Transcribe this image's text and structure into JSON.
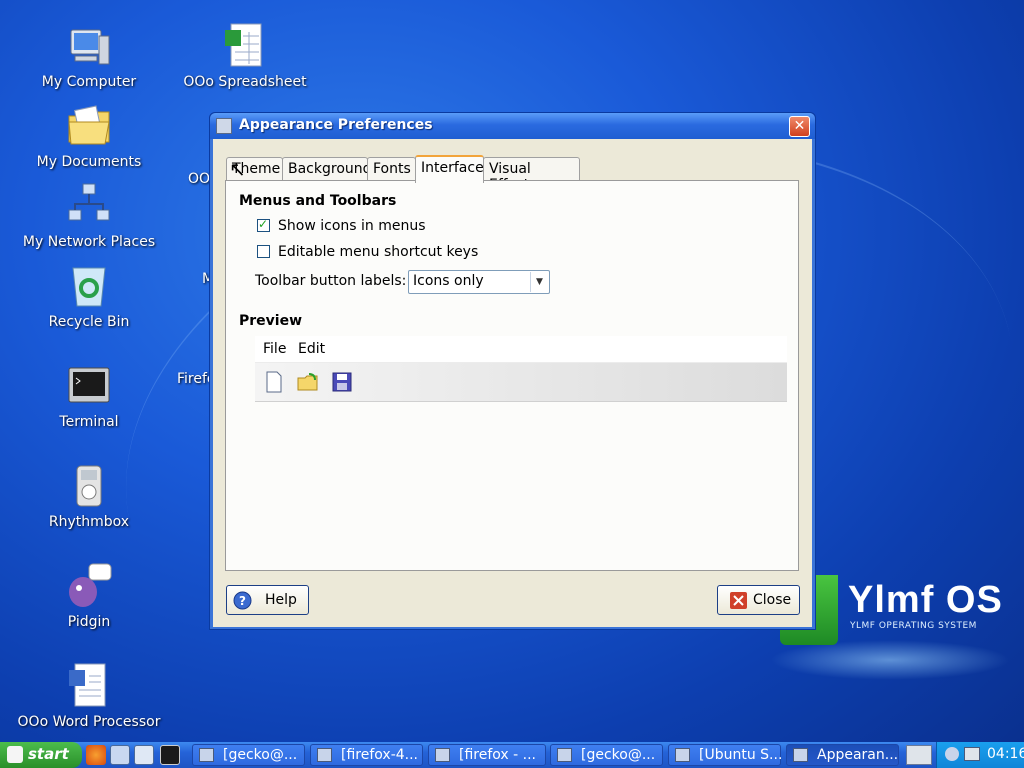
{
  "desktop": {
    "icons": [
      {
        "label": "My Computer",
        "icon": "computer-icon"
      },
      {
        "label": "My Documents",
        "icon": "documents-folder-icon"
      },
      {
        "label": "My Network Places",
        "icon": "network-icon"
      },
      {
        "label": "Recycle Bin",
        "icon": "recycle-bin-icon"
      },
      {
        "label": "Terminal",
        "icon": "terminal-icon"
      },
      {
        "label": "Rhythmbox",
        "icon": "rhythmbox-icon"
      },
      {
        "label": "Pidgin",
        "icon": "pidgin-icon"
      },
      {
        "label": "OOo Word Processor",
        "icon": "word-processor-icon"
      },
      {
        "label": "OOo Spreadsheet",
        "icon": "spreadsheet-icon"
      }
    ],
    "partial_labels": [
      "OO",
      "M",
      "Firefo"
    ],
    "brand": {
      "name": "Ylmf OS",
      "tagline": "YLMF OPERATING SYSTEM"
    }
  },
  "window": {
    "title": "Appearance Preferences",
    "tabs": [
      "Theme",
      "Background",
      "Fonts",
      "Interface",
      "Visual Effects"
    ],
    "active_tab": "Interface",
    "menus_section": {
      "title": "Menus and Toolbars",
      "show_icons_label": "Show icons in menus",
      "show_icons_checked": true,
      "editable_shortcuts_label": "Editable menu shortcut keys",
      "editable_shortcuts_checked": false,
      "toolbar_labels_label": "Toolbar button labels:",
      "toolbar_labels_value": "Icons only"
    },
    "preview": {
      "title": "Preview",
      "menu_file": "File",
      "menu_edit": "Edit",
      "toolbar_icons": [
        "new-document-icon",
        "open-folder-icon",
        "save-icon"
      ]
    },
    "help_label": "Help",
    "close_label": "Close"
  },
  "taskbar": {
    "start_label": "start",
    "tasks": [
      {
        "label": "[gecko@...",
        "active": false
      },
      {
        "label": "[firefox-4...",
        "active": false
      },
      {
        "label": "[firefox - ...",
        "active": false
      },
      {
        "label": "[gecko@...",
        "active": false
      },
      {
        "label": "[Ubuntu S...",
        "active": false
      },
      {
        "label": "Appearan...",
        "active": true
      }
    ],
    "clock": "04:16"
  },
  "colors": {
    "accent_tab": "#f2a43a",
    "title_bar": "#2a6ae0",
    "brand_green": "#49c540"
  }
}
